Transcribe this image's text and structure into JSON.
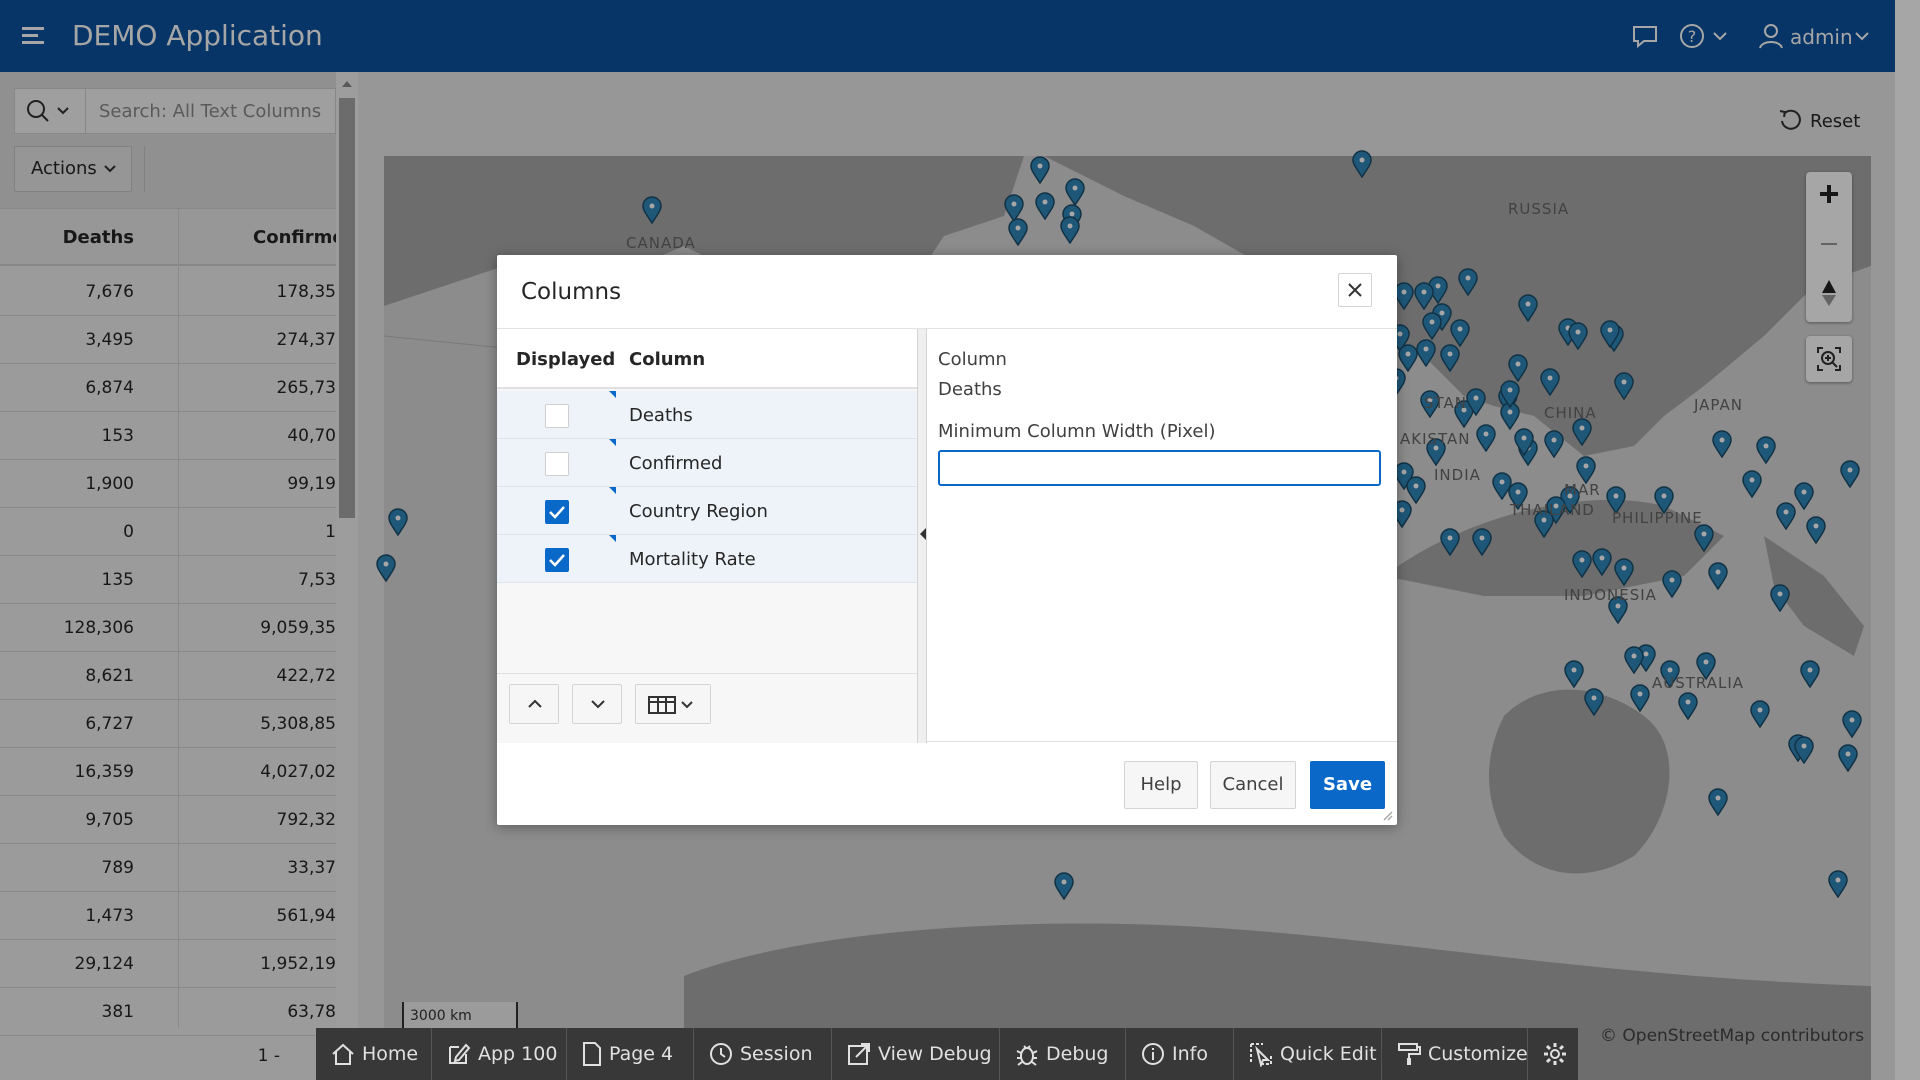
{
  "header": {
    "app_title": "DEMO Application",
    "username": "admin",
    "icons": [
      "menu-icon",
      "chat-icon",
      "help-icon",
      "user-icon"
    ]
  },
  "report": {
    "search_placeholder": "Search: All Text Columns",
    "actions_label": "Actions",
    "columns": [
      "Deaths",
      "Confirmed"
    ],
    "rows": [
      {
        "deaths": "7,676",
        "confirmed": "178,35"
      },
      {
        "deaths": "3,495",
        "confirmed": "274,37"
      },
      {
        "deaths": "6,874",
        "confirmed": "265,73"
      },
      {
        "deaths": "153",
        "confirmed": "40,70"
      },
      {
        "deaths": "1,900",
        "confirmed": "99,19"
      },
      {
        "deaths": "0",
        "confirmed": "1"
      },
      {
        "deaths": "135",
        "confirmed": "7,53"
      },
      {
        "deaths": "128,306",
        "confirmed": "9,059,35"
      },
      {
        "deaths": "8,621",
        "confirmed": "422,72"
      },
      {
        "deaths": "6,727",
        "confirmed": "5,308,85"
      },
      {
        "deaths": "16,359",
        "confirmed": "4,027,02"
      },
      {
        "deaths": "9,705",
        "confirmed": "792,32"
      },
      {
        "deaths": "789",
        "confirmed": "33,37"
      },
      {
        "deaths": "1,473",
        "confirmed": "561,94"
      },
      {
        "deaths": "29,124",
        "confirmed": "1,952,19"
      },
      {
        "deaths": "381",
        "confirmed": "63,78"
      }
    ],
    "pagination": "1 -"
  },
  "map": {
    "reset_label": "Reset",
    "labels": [
      "CANADA",
      "RUSSIA",
      "CHINA",
      "JAPAN",
      "INDIA",
      "INDONESIA",
      "AUSTRALIA",
      "THAILAND",
      "PHILIPPINE",
      "AKISTAN",
      "STAN",
      "MAR"
    ],
    "scale": "3000 km",
    "attribution": "© OpenStreetMap contributors",
    "marker_color": "#2e86b8"
  },
  "dialog": {
    "title": "Columns",
    "col_displayed": "Displayed",
    "col_column": "Column",
    "columns": [
      {
        "name": "Deaths",
        "displayed": false
      },
      {
        "name": "Confirmed",
        "displayed": false
      },
      {
        "name": "Country Region",
        "displayed": true
      },
      {
        "name": "Mortality Rate",
        "displayed": true
      }
    ],
    "detail_label": "Column",
    "detail_value": "Deaths",
    "min_width_label": "Minimum Column Width (Pixel)",
    "min_width_value": "",
    "help_label": "Help",
    "cancel_label": "Cancel",
    "save_label": "Save",
    "accent": "#0a68c9"
  },
  "dev_toolbar": {
    "items": [
      "Home",
      "App 100",
      "Page 4",
      "Session",
      "View Debug",
      "Debug",
      "Info",
      "Quick Edit",
      "Customize"
    ]
  }
}
